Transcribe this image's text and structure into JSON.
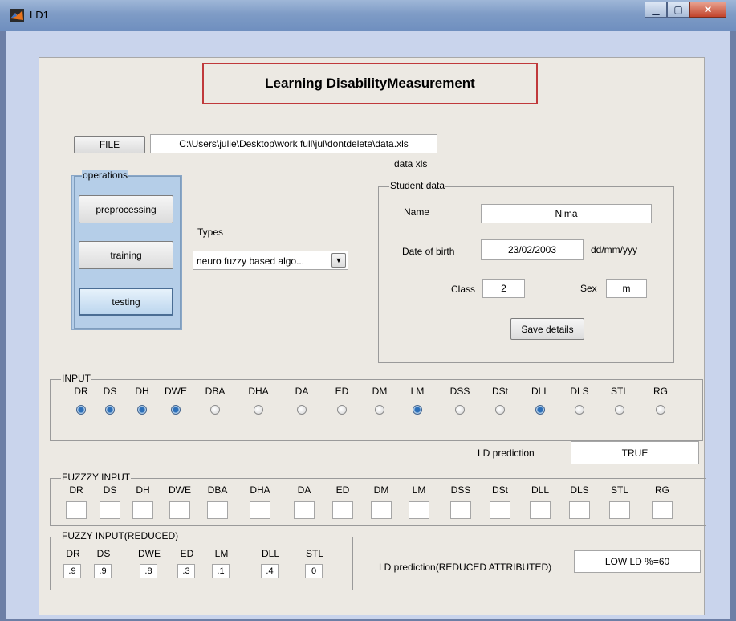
{
  "window": {
    "title": "LD1"
  },
  "header": {
    "title": "Learning DisabilityMeasurement"
  },
  "file": {
    "button_label": "FILE",
    "path": "C:\\Users\\julie\\Desktop\\work full\\jul\\dontdelete\\data.xls",
    "caption": "data xls"
  },
  "operations": {
    "label": "operations",
    "buttons": [
      "preprocessing",
      "training",
      "testing"
    ]
  },
  "types": {
    "label": "Types",
    "selected": "neuro fuzzy based algo..."
  },
  "student": {
    "label": "Student data",
    "name_label": "Name",
    "name": "Nima",
    "dob_label": "Date of birth",
    "dob": "23/02/2003",
    "dob_format": "dd/mm/yyy",
    "class_label": "Class",
    "class": "2",
    "sex_label": "Sex",
    "sex": "m",
    "save_label": "Save details"
  },
  "input": {
    "label": "INPUT",
    "attributes": [
      "DR",
      "DS",
      "DH",
      "DWE",
      "DBA",
      "DHA",
      "DA",
      "ED",
      "DM",
      "LM",
      "DSS",
      "DSt",
      "DLL",
      "DLS",
      "STL",
      "RG"
    ],
    "selected": [
      true,
      true,
      true,
      true,
      false,
      false,
      false,
      false,
      false,
      true,
      false,
      false,
      true,
      false,
      false,
      false
    ]
  },
  "prediction": {
    "label": "LD prediction",
    "value": "TRUE"
  },
  "fuzzy_input": {
    "label": "FUZZZY INPUT",
    "attributes": [
      "DR",
      "DS",
      "DH",
      "DWE",
      "DBA",
      "DHA",
      "DA",
      "ED",
      "DM",
      "LM",
      "DSS",
      "DSt",
      "DLL",
      "DLS",
      "STL",
      "RG"
    ]
  },
  "fuzzy_reduced": {
    "label": "FUZZY INPUT(REDUCED)",
    "attributes": [
      "DR",
      "DS",
      "DWE",
      "ED",
      "LM",
      "DLL",
      "STL"
    ],
    "values": [
      ".9",
      ".9",
      ".8",
      ".3",
      ".1",
      ".4",
      "0"
    ]
  },
  "reduced_prediction": {
    "label": "LD prediction(REDUCED ATTRIBUTED)",
    "value": "LOW  LD %=60"
  },
  "colors": {
    "title_border": "#c0393b",
    "operations_bg": "#b5cee8",
    "window_bg": "#ece9e3"
  }
}
